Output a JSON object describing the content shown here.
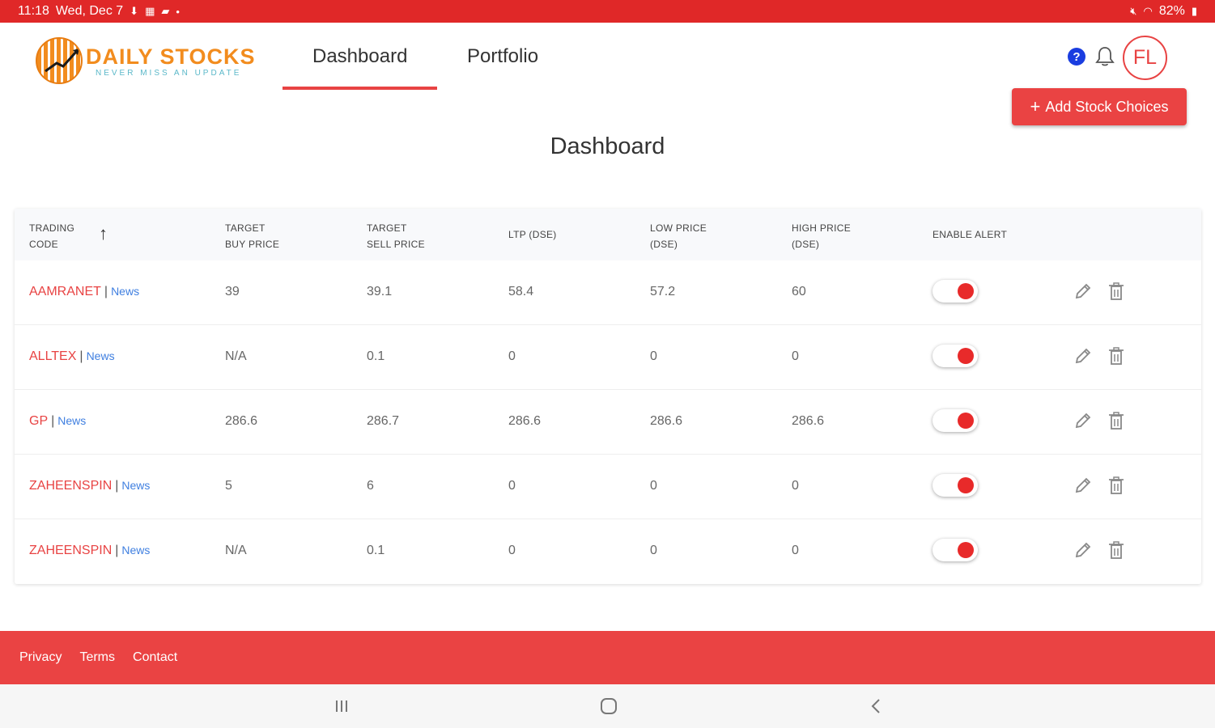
{
  "statusbar": {
    "time": "11:18",
    "date": "Wed, Dec 7",
    "battery": "82%"
  },
  "brand": {
    "title": "DAILY STOCKS",
    "tagline": "NEVER MISS AN UPDATE"
  },
  "nav": {
    "tabs": [
      {
        "label": "Dashboard"
      },
      {
        "label": "Portfolio"
      }
    ],
    "active": "Dashboard"
  },
  "header": {
    "help_symbol": "?",
    "avatar_initials": "FL"
  },
  "actions": {
    "add_label": "Add Stock Choices"
  },
  "page": {
    "title": "Dashboard"
  },
  "table": {
    "headers": {
      "code": [
        "TRADING",
        "CODE"
      ],
      "buy": [
        "TARGET",
        "BUY PRICE"
      ],
      "sell": [
        "TARGET",
        "SELL PRICE"
      ],
      "ltp": "LTP (DSE)",
      "low": [
        "LOW PRICE",
        "(DSE)"
      ],
      "high": [
        "HIGH PRICE",
        "(DSE)"
      ],
      "alert": "ENABLE ALERT"
    },
    "news_label": "News",
    "separator": "|",
    "rows": [
      {
        "code": "AAMRANET",
        "buy": "39",
        "sell": "39.1",
        "ltp": "58.4",
        "low": "57.2",
        "high": "60",
        "alert": true
      },
      {
        "code": "ALLTEX",
        "buy": "N/A",
        "sell": "0.1",
        "ltp": "0",
        "low": "0",
        "high": "0",
        "alert": true
      },
      {
        "code": "GP",
        "buy": "286.6",
        "sell": "286.7",
        "ltp": "286.6",
        "low": "286.6",
        "high": "286.6",
        "alert": true
      },
      {
        "code": "ZAHEENSPIN",
        "buy": "5",
        "sell": "6",
        "ltp": "0",
        "low": "0",
        "high": "0",
        "alert": true
      },
      {
        "code": "ZAHEENSPIN",
        "buy": "N/A",
        "sell": "0.1",
        "ltp": "0",
        "low": "0",
        "high": "0",
        "alert": true
      }
    ]
  },
  "footer": {
    "links": [
      "Privacy",
      "Terms",
      "Contact"
    ]
  },
  "colors": {
    "brand_red": "#ea4343",
    "status_red": "#e02828",
    "logo_orange": "#f28c1e",
    "link_blue": "#3f7fe0"
  }
}
